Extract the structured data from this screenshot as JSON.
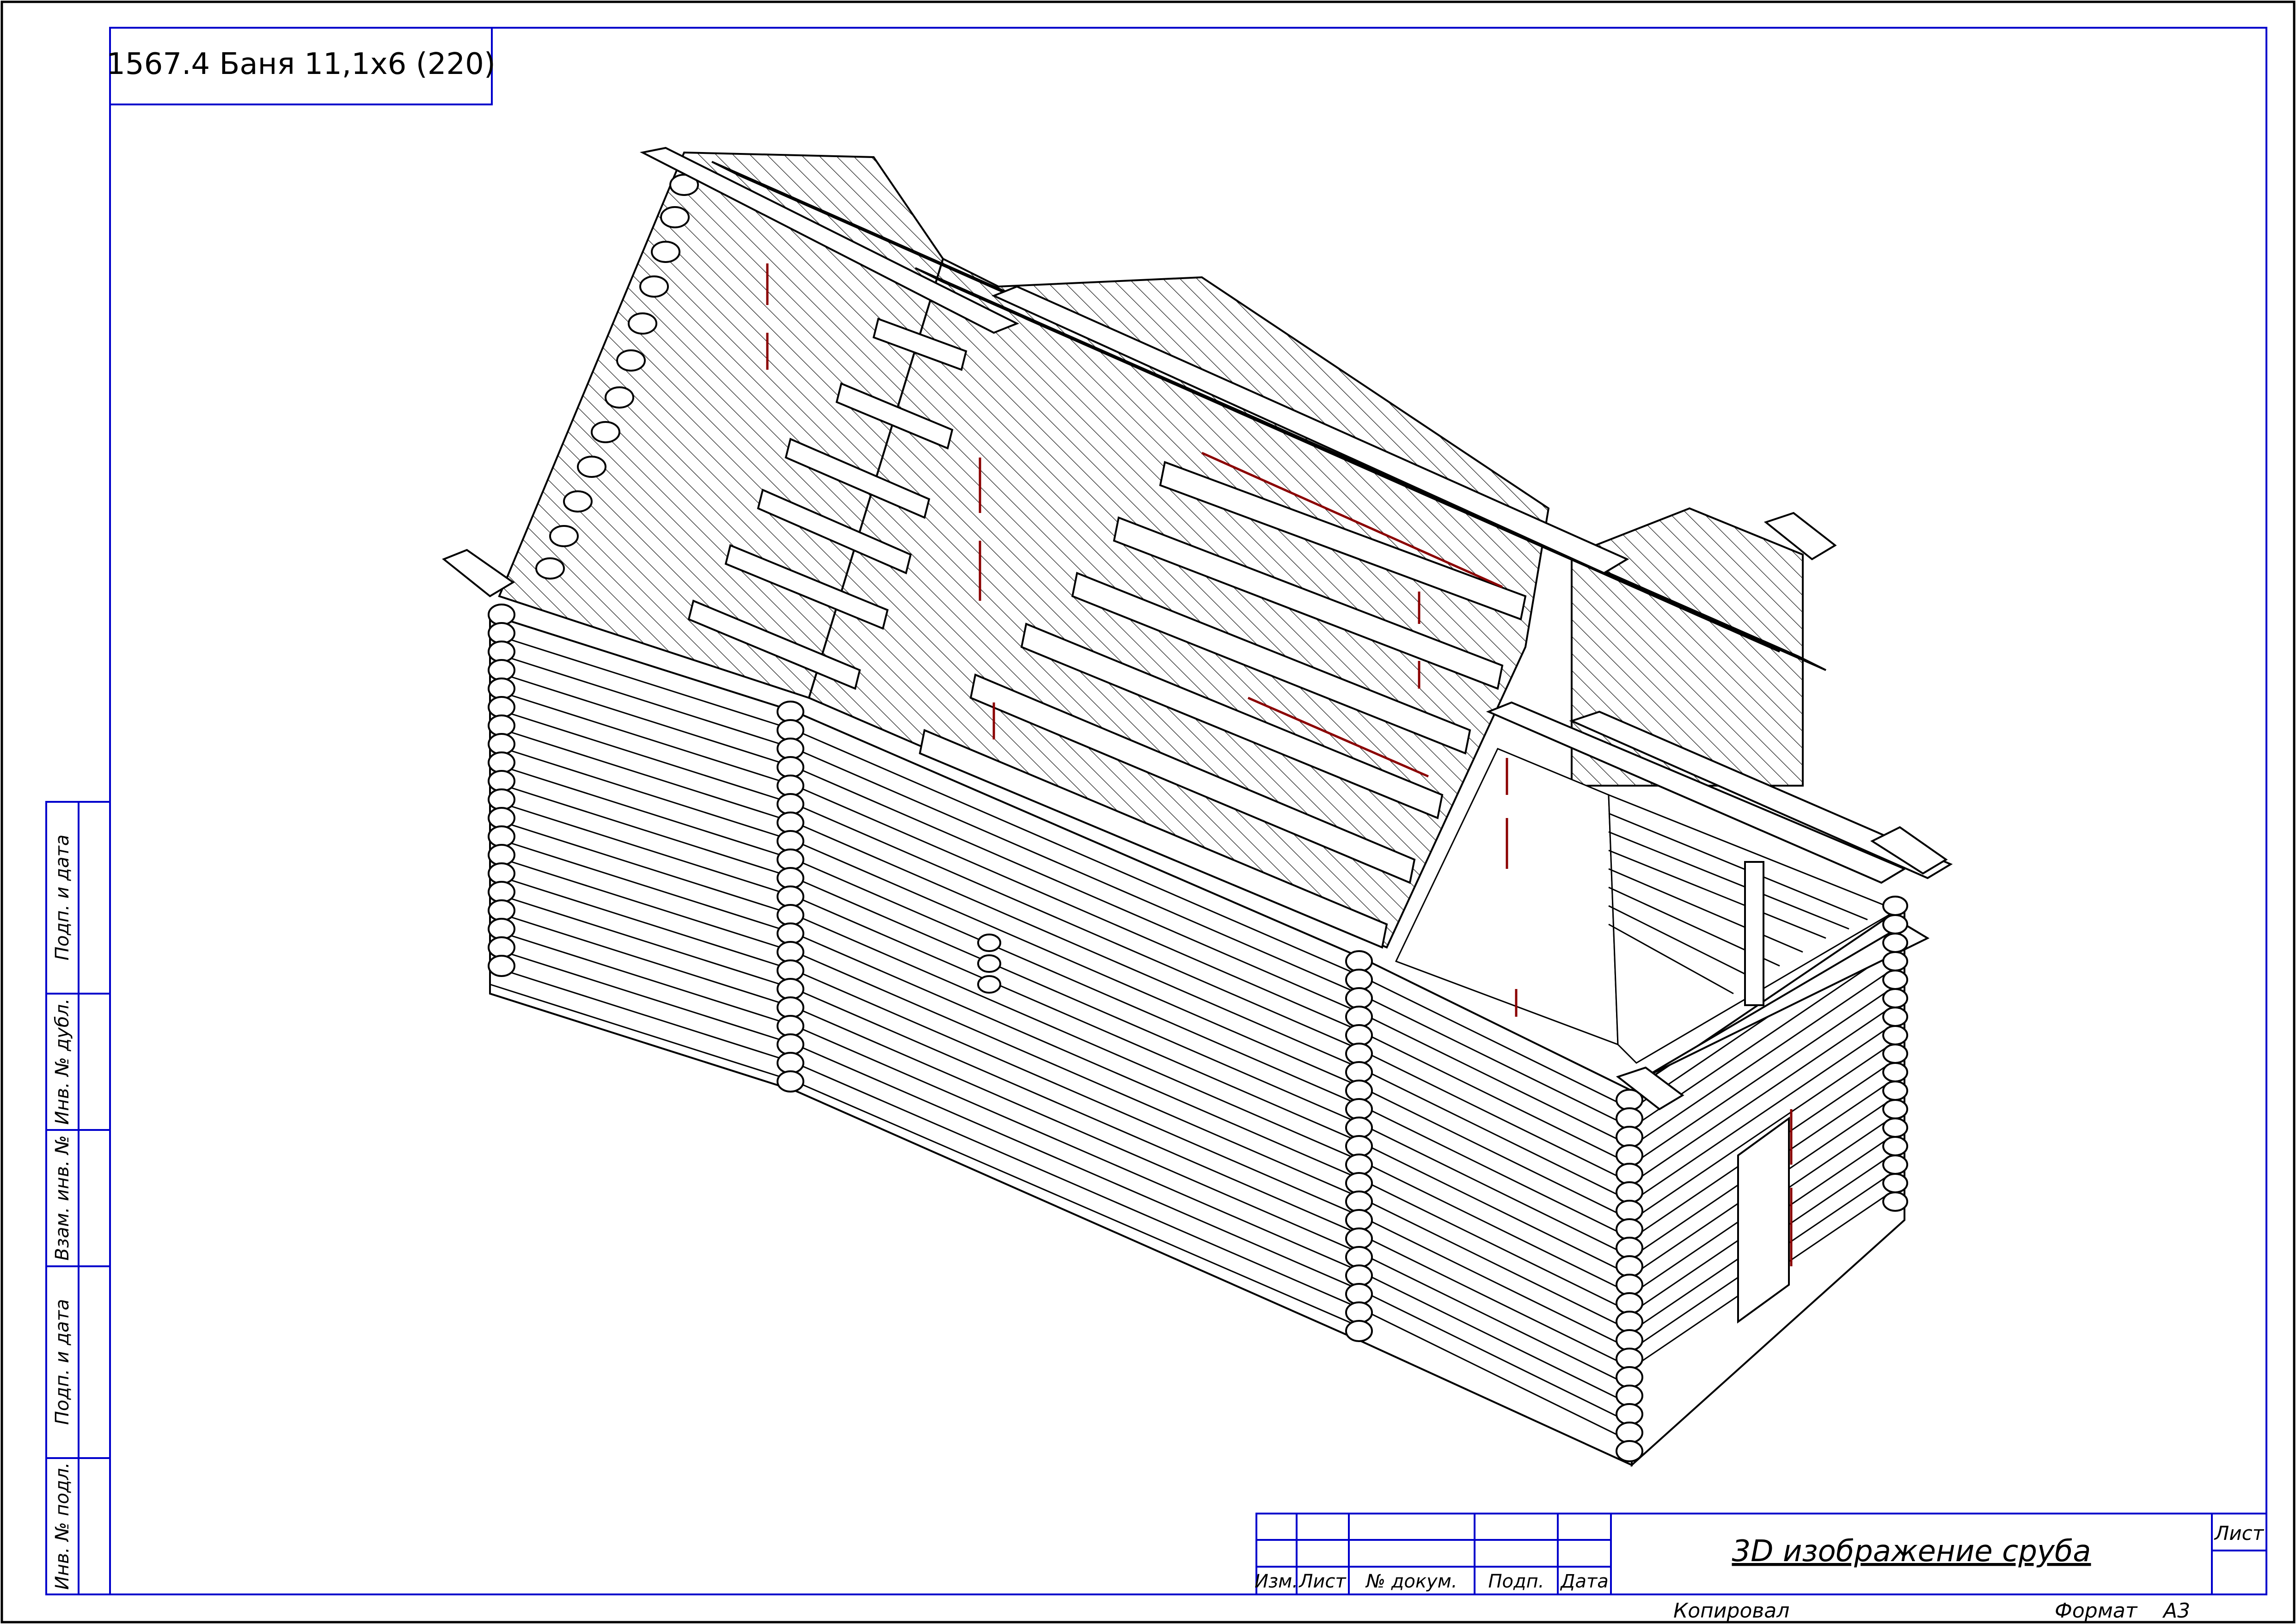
{
  "title_tag": {
    "text": "1567.4 Баня 11,1х6 (220)"
  },
  "title_block": {
    "headers": [
      "Изм.",
      "Лист",
      "№ докум.",
      "Подп.",
      "Дата"
    ],
    "drawing_name": "3D изображение сруба",
    "sheet_label": "Лист",
    "copied_label": "Копировал",
    "format_label": "Формат",
    "format_value": "А3"
  },
  "side_stamps": [
    "Подп. и дата",
    "Инв. № дубл.",
    "Взам. инв. №",
    "Подп. и дата",
    "Инв. № подл."
  ],
  "colors": {
    "frame": "#0000cc",
    "outline": "#000000",
    "hatch": "#000000",
    "accent": "#8b0000",
    "sheet": "#ffffff"
  }
}
